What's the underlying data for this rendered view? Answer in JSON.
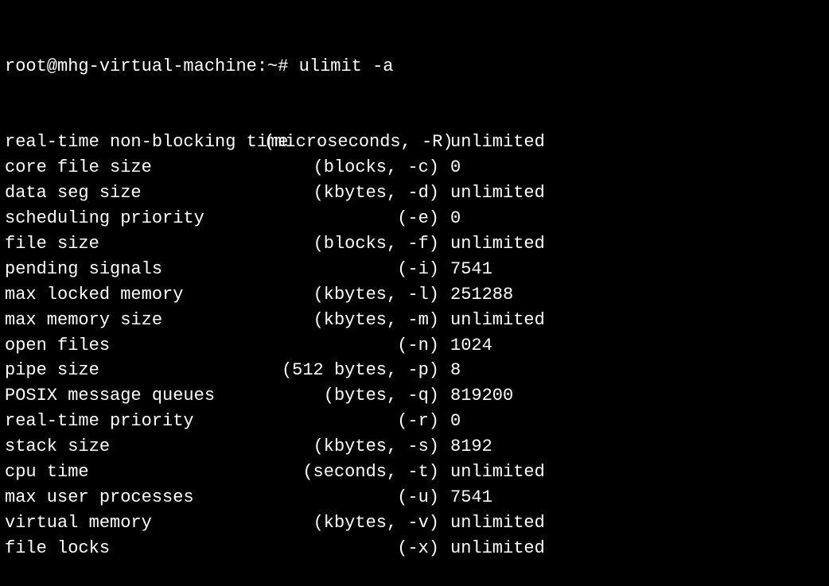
{
  "prompt": "root@mhg-virtual-machine:~# ",
  "command": "ulimit -a",
  "limits": [
    {
      "name": "real-time non-blocking time",
      "unit": "(microseconds, -R)",
      "value": "unlimited"
    },
    {
      "name": "core file size",
      "unit": "(blocks, -c)",
      "value": "0"
    },
    {
      "name": "data seg size",
      "unit": "(kbytes, -d)",
      "value": "unlimited"
    },
    {
      "name": "scheduling priority",
      "unit": "(-e)",
      "value": "0"
    },
    {
      "name": "file size",
      "unit": "(blocks, -f)",
      "value": "unlimited"
    },
    {
      "name": "pending signals",
      "unit": "(-i)",
      "value": "7541"
    },
    {
      "name": "max locked memory",
      "unit": "(kbytes, -l)",
      "value": "251288"
    },
    {
      "name": "max memory size",
      "unit": "(kbytes, -m)",
      "value": "unlimited"
    },
    {
      "name": "open files",
      "unit": "(-n)",
      "value": "1024"
    },
    {
      "name": "pipe size",
      "unit": "(512 bytes, -p)",
      "value": "8"
    },
    {
      "name": "POSIX message queues",
      "unit": "(bytes, -q)",
      "value": "819200"
    },
    {
      "name": "real-time priority",
      "unit": "(-r)",
      "value": "0"
    },
    {
      "name": "stack size",
      "unit": "(kbytes, -s)",
      "value": "8192"
    },
    {
      "name": "cpu time",
      "unit": "(seconds, -t)",
      "value": "unlimited"
    },
    {
      "name": "max user processes",
      "unit": "(-u)",
      "value": "7541"
    },
    {
      "name": "virtual memory",
      "unit": "(kbytes, -v)",
      "value": "unlimited"
    },
    {
      "name": "file locks",
      "unit": "(-x)",
      "value": "unlimited"
    }
  ]
}
